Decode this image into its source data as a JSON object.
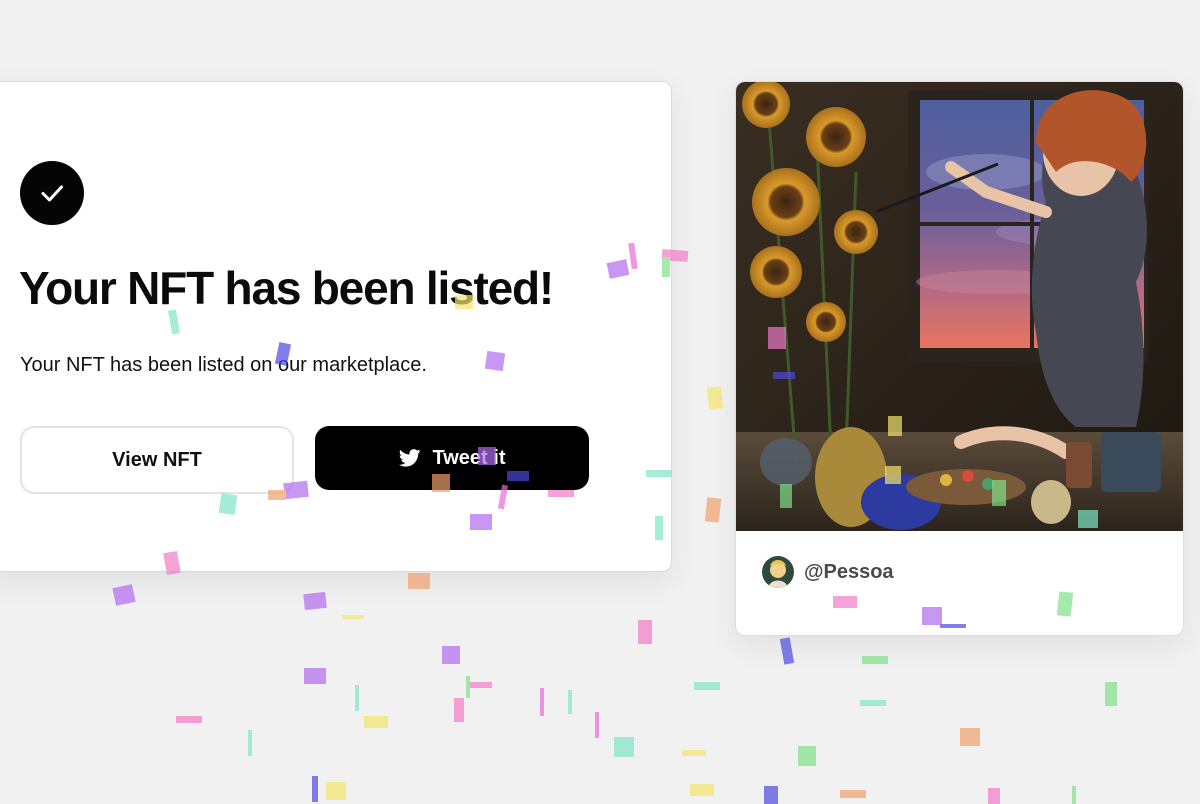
{
  "listing": {
    "status_icon": "check-icon",
    "headline": "Your NFT has been listed!",
    "message": "Your NFT has been listed on our marketplace.",
    "view_button_label": "View NFT",
    "tweet_button_label": "Tweet it",
    "tweet_icon": "twitter-icon"
  },
  "nft": {
    "creator_handle": "@Pessoa"
  },
  "colors": {
    "page_background": "#f1f1f1",
    "card_background": "#ffffff",
    "primary_button": "#000000",
    "primary_text": "#0b0b0b"
  }
}
